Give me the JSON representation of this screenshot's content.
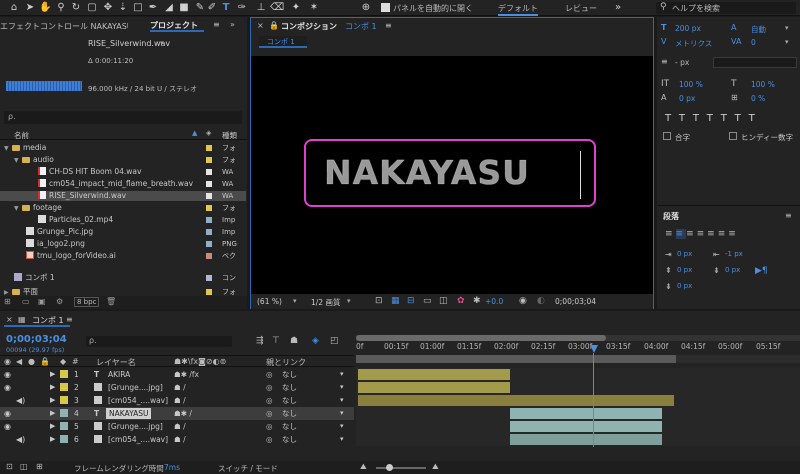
{
  "toolbar": {
    "auto_open_label": "パネルを自動的に開く",
    "workspace_default": "デフォルト",
    "workspace_review": "レビュー",
    "search_help": "ヘルプを検索"
  },
  "project_panel": {
    "tab_effects": "エフェクトコントロール NAKAYASU",
    "tab_project": "プロジェクト",
    "selected_file": "RISE_Silverwind.wav",
    "duration": "Δ 0:00:11:20",
    "audio_info": "96.000 kHz / 24 bit U / ステレオ",
    "search_placeholder": "ρ.",
    "col_name": "名前",
    "col_kind": "種類",
    "bpc": "8 bpc",
    "items": [
      {
        "name": "media",
        "kind": "フォ"
      },
      {
        "name": "audio",
        "kind": "フォ"
      },
      {
        "name": "CH-DS HIT Boom 04.wav",
        "kind": "WA"
      },
      {
        "name": "cm054_impact_mid_flame_breath.wav",
        "kind": "WA"
      },
      {
        "name": "RISE_Silverwind.wav",
        "kind": "WA"
      },
      {
        "name": "footage",
        "kind": "フォ"
      },
      {
        "name": "Particles_02.mp4",
        "kind": "Imp"
      },
      {
        "name": "Grunge_Pic.jpg",
        "kind": "Imp"
      },
      {
        "name": "ia_logo2.png",
        "kind": "PNG"
      },
      {
        "name": "tmu_logo_forVideo.ai",
        "kind": "ベク"
      },
      {
        "name": "コンポ 1",
        "kind": "コン"
      },
      {
        "name": "平面",
        "kind": "フォ"
      }
    ]
  },
  "composition": {
    "tab_label": "コンポジション",
    "comp_name": "コンポ 1",
    "sub_tab": "コンポ 1",
    "title_text": "NAKAYASU",
    "zoom": "(61 %)",
    "resolution": "1/2 画質",
    "exposure": "+0.0",
    "timecode": "0;00;03;04"
  },
  "character_panel": {
    "font_size": "200 px",
    "leading": "自動",
    "kerning": "メトリクス",
    "tracking": "0",
    "stroke": "- px",
    "vscale": "100 %",
    "hscale": "100 %",
    "baseline": "0 px",
    "tsume": "0 %",
    "ligature": "合字",
    "hindi": "ヒンディー数字"
  },
  "paragraph_panel": {
    "title": "段落",
    "indent_left": "0 px",
    "indent_first": "-1 px",
    "indent_right": "0 px",
    "space_before": "0 px",
    "space_after": "0 px"
  },
  "timeline": {
    "tab": "コンポ 1",
    "current_time": "0;00;03;04",
    "frame_info": "00094 (29.97 fps)",
    "col_layer_name": "レイヤー名",
    "col_parent": "親とリンク",
    "ruler": [
      "0f",
      "00:15f",
      "01:00f",
      "01:15f",
      "02:00f",
      "02:15f",
      "03:00f",
      "03:15f",
      "04:00f",
      "04:15f",
      "05:00f",
      "05:15f"
    ],
    "layers": [
      {
        "num": "1",
        "name": "AKIRA",
        "parent": "なし"
      },
      {
        "num": "2",
        "name": "[Grunge....jpg]",
        "parent": "なし"
      },
      {
        "num": "3",
        "name": "[cm054_....wav]",
        "parent": "なし"
      },
      {
        "num": "4",
        "name": "NAKAYASU",
        "parent": "なし"
      },
      {
        "num": "5",
        "name": "[Grunge....jpg]",
        "parent": "なし"
      },
      {
        "num": "6",
        "name": "[cm054_....wav]",
        "parent": "なし"
      }
    ],
    "footer_render": "フレームレンダリング時間",
    "footer_render_value": "7ms",
    "footer_switch": "スイッチ / モード"
  },
  "colors": {
    "accent": "#2d6ab5",
    "selection_outline": "#e040d0",
    "label_yellow": "#d8c84a",
    "layer_bar_gold": "#a39a4c",
    "layer_bar_cyan": "#8fb3b0"
  }
}
